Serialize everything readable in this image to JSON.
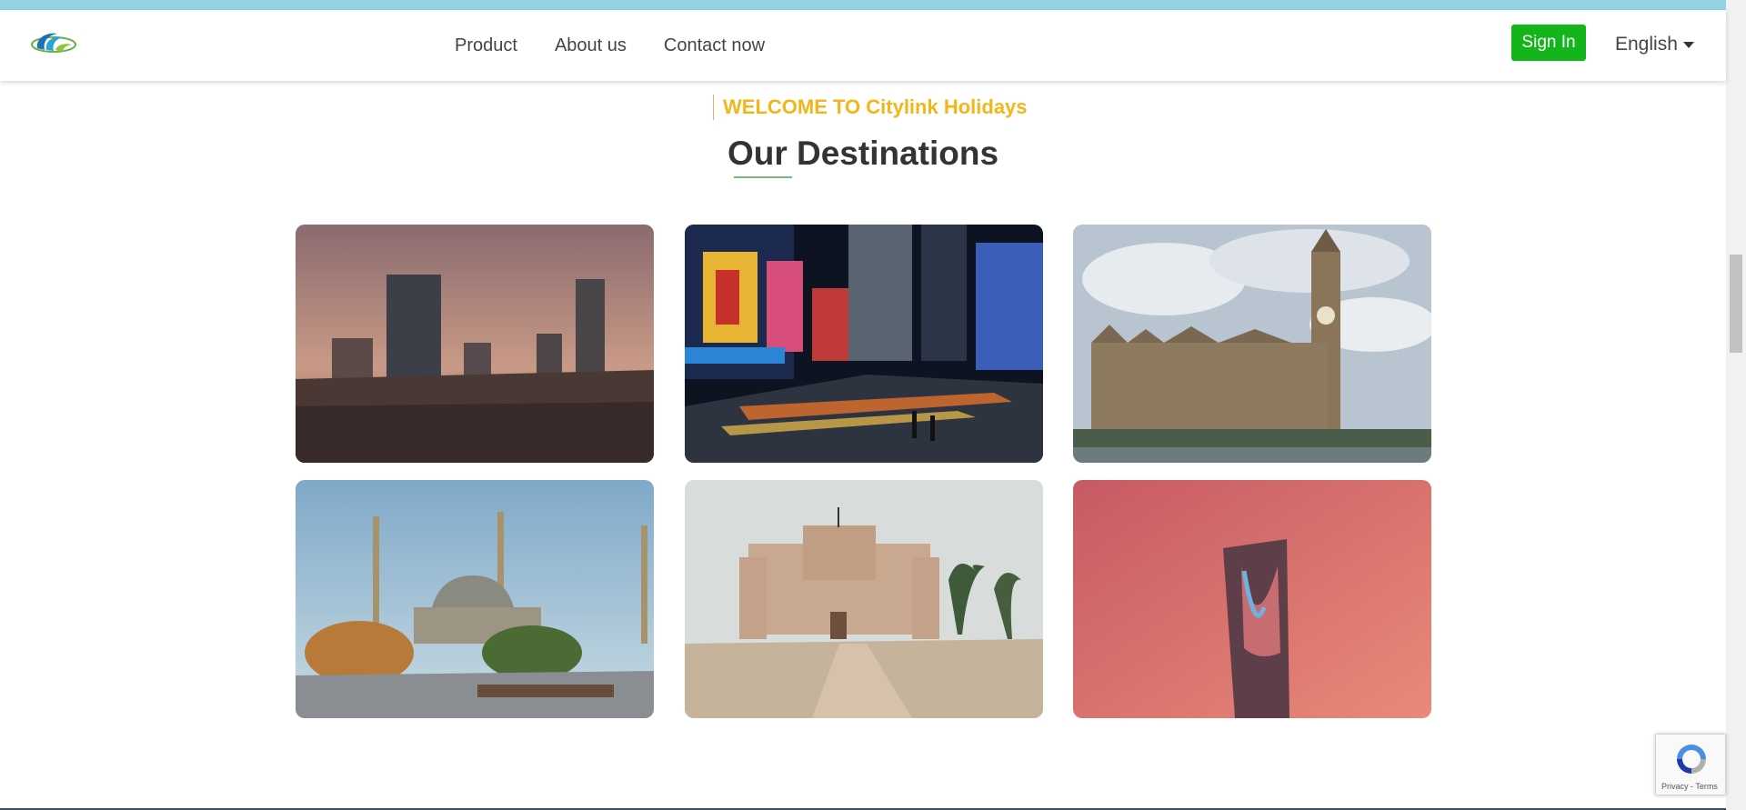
{
  "nav": {
    "logo_icon": "citylink-logo-icon",
    "links": [
      "Product",
      "About us",
      "Contact now"
    ],
    "signin_label": "Sign In",
    "language": "English"
  },
  "hero": {
    "welcome": "WELCOME TO Citylink Holidays",
    "heading": "Our Destinations"
  },
  "destinations": [
    {
      "scene": "city-skyline-dusk"
    },
    {
      "scene": "times-square-night"
    },
    {
      "scene": "big-ben-westminster"
    },
    {
      "scene": "blue-mosque-istanbul"
    },
    {
      "scene": "citadel-of-qaitbay"
    },
    {
      "scene": "kingdom-tower-riyadh"
    }
  ],
  "recaptcha": {
    "icon": "recaptcha-icon",
    "privacy": "Privacy",
    "separator": " - ",
    "terms": "Terms"
  },
  "colors": {
    "accent_top": "#94d3e4",
    "signin_bg": "#13b51b",
    "welcome_text": "#f2b619",
    "heading_text": "#333333"
  }
}
